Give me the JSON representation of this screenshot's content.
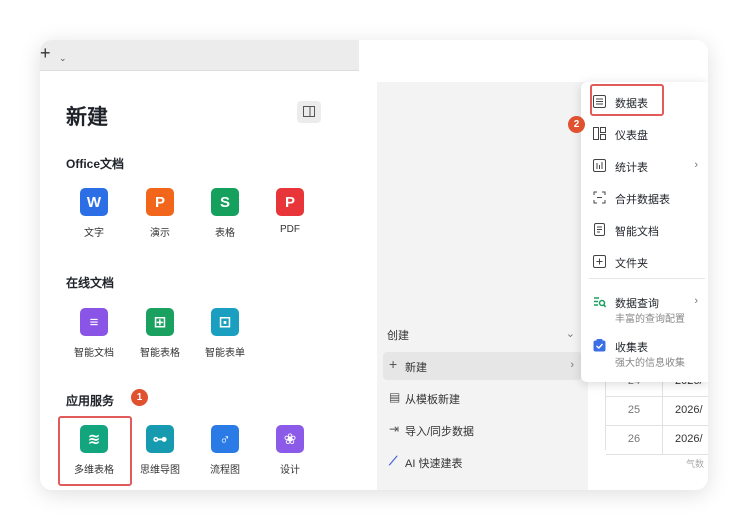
{
  "left": {
    "title": "新建",
    "sections": [
      {
        "label": "Office文档",
        "apps": [
          {
            "label": "文字",
            "glyph": "W",
            "color": "#2b6ee6",
            "icon": "word-icon"
          },
          {
            "label": "演示",
            "glyph": "P",
            "color": "#f2661b",
            "icon": "presentation-icon"
          },
          {
            "label": "表格",
            "glyph": "S",
            "color": "#16a05d",
            "icon": "spreadsheet-icon"
          },
          {
            "label": "PDF",
            "glyph": "P",
            "color": "#e8353a",
            "icon": "pdf-icon"
          }
        ]
      },
      {
        "label": "在线文档",
        "apps": [
          {
            "label": "智能文档",
            "glyph": "≡",
            "color": "#8a55e6",
            "icon": "smart-doc-icon"
          },
          {
            "label": "智能表格",
            "glyph": "⊞",
            "color": "#1aa160",
            "icon": "smart-sheet-icon"
          },
          {
            "label": "智能表单",
            "glyph": "⊡",
            "color": "#1a9fc0",
            "icon": "smart-form-icon"
          }
        ]
      },
      {
        "label": "应用服务",
        "apps": [
          {
            "label": "多维表格",
            "glyph": "≋",
            "color": "#13a57d",
            "icon": "multidim-table-icon"
          },
          {
            "label": "思维导图",
            "glyph": "⊶",
            "color": "#159ab0",
            "icon": "mindmap-icon"
          },
          {
            "label": "流程图",
            "glyph": "♂",
            "color": "#2a7be6",
            "icon": "flowchart-icon"
          },
          {
            "label": "设计",
            "glyph": "❀",
            "color": "#8c5ae8",
            "icon": "design-icon"
          }
        ]
      }
    ],
    "badge1": "1"
  },
  "create_panel": {
    "header": "创建",
    "items": [
      {
        "label": "新建",
        "icon": "plus-icon"
      },
      {
        "label": "从模板新建",
        "icon": "template-icon"
      },
      {
        "label": "导入/同步数据",
        "icon": "import-icon"
      },
      {
        "label": "AI 快速建表",
        "icon": "ai-icon"
      }
    ]
  },
  "menu": {
    "badge2": "2",
    "items": [
      {
        "label": "数据表",
        "icon": "datatable-icon"
      },
      {
        "label": "仪表盘",
        "icon": "dashboard-icon"
      },
      {
        "label": "统计表",
        "icon": "stats-icon"
      },
      {
        "label": "合并数据表",
        "icon": "merge-icon"
      },
      {
        "label": "智能文档",
        "icon": "smart-doc-icon"
      },
      {
        "label": "文件夹",
        "icon": "folder-icon"
      },
      {
        "label": "数据查询",
        "sub": "丰富的查询配置",
        "icon": "query-icon"
      },
      {
        "label": "收集表",
        "sub": "强大的信息收集",
        "icon": "collect-icon"
      }
    ]
  },
  "table": {
    "rows": [
      {
        "n": "24",
        "d": "2026/"
      },
      {
        "n": "25",
        "d": "2026/"
      },
      {
        "n": "26",
        "d": "2026/"
      }
    ],
    "footer": "气数"
  }
}
